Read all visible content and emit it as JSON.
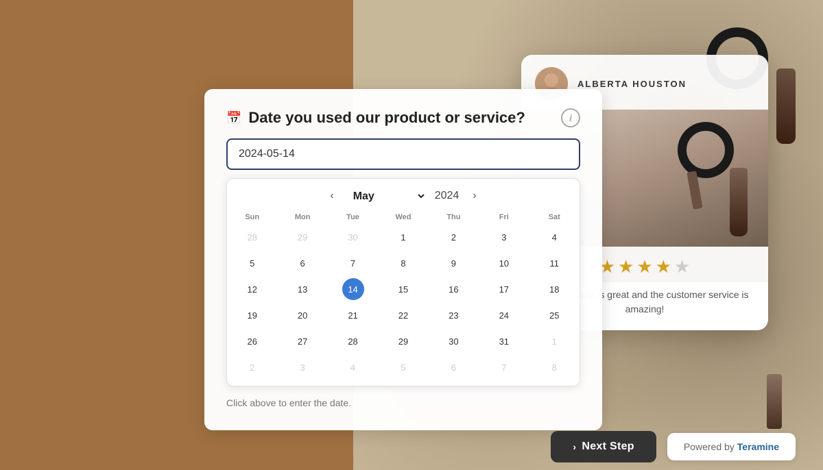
{
  "background": {
    "left_color": "#a07040",
    "right_color": "#c8b89a"
  },
  "reviewer": {
    "name": "ALBERTA HOUSTON",
    "avatar_alt": "reviewer avatar"
  },
  "review": {
    "stars_filled": 4,
    "stars_total": 5,
    "text": "Your product is great and the customer service is amazing!"
  },
  "form": {
    "title": "Date you used our product or service?",
    "date_value": "2024-05-14",
    "hint_text": "Click above to enter the date.",
    "calendar": {
      "month": "May",
      "year": "2024",
      "days_header": [
        "Sun",
        "Mon",
        "Tue",
        "Wed",
        "Thu",
        "Fri",
        "Sat"
      ],
      "weeks": [
        [
          {
            "day": 28,
            "type": "other"
          },
          {
            "day": 29,
            "type": "other"
          },
          {
            "day": 30,
            "type": "other"
          },
          {
            "day": 1,
            "type": "current"
          },
          {
            "day": 2,
            "type": "current"
          },
          {
            "day": 3,
            "type": "current"
          },
          {
            "day": 4,
            "type": "current"
          }
        ],
        [
          {
            "day": 5,
            "type": "current"
          },
          {
            "day": 6,
            "type": "current"
          },
          {
            "day": 7,
            "type": "current"
          },
          {
            "day": 8,
            "type": "current"
          },
          {
            "day": 9,
            "type": "current"
          },
          {
            "day": 10,
            "type": "current"
          },
          {
            "day": 11,
            "type": "current"
          }
        ],
        [
          {
            "day": 12,
            "type": "current"
          },
          {
            "day": 13,
            "type": "current"
          },
          {
            "day": 14,
            "type": "selected"
          },
          {
            "day": 15,
            "type": "current"
          },
          {
            "day": 16,
            "type": "current"
          },
          {
            "day": 17,
            "type": "current"
          },
          {
            "day": 18,
            "type": "current"
          }
        ],
        [
          {
            "day": 19,
            "type": "current"
          },
          {
            "day": 20,
            "type": "current"
          },
          {
            "day": 21,
            "type": "current"
          },
          {
            "day": 22,
            "type": "current"
          },
          {
            "day": 23,
            "type": "current"
          },
          {
            "day": 24,
            "type": "current"
          },
          {
            "day": 25,
            "type": "current"
          }
        ],
        [
          {
            "day": 26,
            "type": "current"
          },
          {
            "day": 27,
            "type": "current"
          },
          {
            "day": 28,
            "type": "current"
          },
          {
            "day": 29,
            "type": "current"
          },
          {
            "day": 30,
            "type": "current"
          },
          {
            "day": 31,
            "type": "current"
          },
          {
            "day": 1,
            "type": "other"
          }
        ],
        [
          {
            "day": 2,
            "type": "other"
          },
          {
            "day": 3,
            "type": "other"
          },
          {
            "day": 4,
            "type": "other"
          },
          {
            "day": 5,
            "type": "other"
          },
          {
            "day": 6,
            "type": "other"
          },
          {
            "day": 7,
            "type": "other"
          },
          {
            "day": 8,
            "type": "other"
          }
        ]
      ]
    }
  },
  "bottom": {
    "next_step_label": "Next Step",
    "powered_by_label": "Powered by",
    "brand_label": "Teramine"
  }
}
